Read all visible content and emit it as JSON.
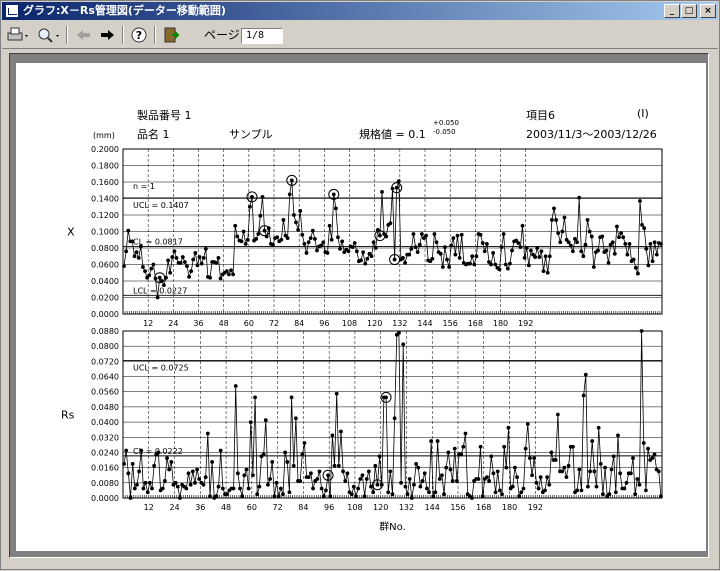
{
  "window": {
    "title": "グラフ:X－Rs管理図(データー移動範囲)",
    "minimize": "_",
    "maximize": "□",
    "close": "×"
  },
  "toolbar": {
    "icons": [
      "printer-icon",
      "zoom-icon",
      "back-arrow-icon",
      "forward-arrow-icon",
      "help-icon",
      "exit-icon"
    ],
    "page_label": "ページ:",
    "page_value": "1/8"
  },
  "report": {
    "product_no": "製品番号 1",
    "product_name": "品名 1",
    "sample": "サンプル",
    "spec_label": "規格値 = 0.1",
    "spec_plus": "+0.050",
    "spec_minus": "-0.050",
    "item": "項目6",
    "item_code": "(I)",
    "date_range": "2003/11/3～2003/12/26",
    "unit": "(mm)"
  },
  "chart_data": [
    {
      "type": "line",
      "ylabel": "X",
      "xlabel": "群No.",
      "ylim": [
        0,
        0.2
      ],
      "yticks": [
        "0.2000",
        "0.1800",
        "0.1600",
        "0.1400",
        "0.1200",
        "0.1000",
        "0.0800",
        "0.0600",
        "0.0400",
        "0.0200",
        "0.0000"
      ],
      "xticks": [
        "12",
        "24",
        "36",
        "48",
        "60",
        "72",
        "84",
        "96",
        "108",
        "120",
        "132",
        "144",
        "156",
        "168",
        "180",
        "192"
      ],
      "annotations": {
        "n": "n = 1",
        "ucl": "UCL = 0.1407",
        "cl": "CL = 0.0817",
        "lcl": "LCL = 0.0227"
      },
      "ucl": 0.1407,
      "cl": 0.0817,
      "lcl": 0.0227,
      "values": [
        0.058,
        0.076,
        0.101,
        0.088,
        0.088,
        0.07,
        0.075,
        0.068,
        0.082,
        0.057,
        0.052,
        0.044,
        0.047,
        0.055,
        0.06,
        0.043,
        0.02,
        0.044,
        0.04,
        0.035,
        0.044,
        0.065,
        0.05,
        0.069,
        0.076,
        0.068,
        0.062,
        0.062,
        0.069,
        0.063,
        0.058,
        0.045,
        0.052,
        0.066,
        0.074,
        0.059,
        0.069,
        0.061,
        0.068,
        0.079,
        0.045,
        0.044,
        0.063,
        0.063,
        0.062,
        0.068,
        0.043,
        0.048,
        0.05,
        0.052,
        0.048,
        0.053,
        0.048,
        0.107,
        0.094,
        0.089,
        0.088,
        0.1,
        0.085,
        0.09,
        0.13,
        0.142,
        0.089,
        0.091,
        0.097,
        0.119,
        0.142,
        0.101,
        0.094,
        0.104,
        0.085,
        0.084,
        0.092,
        0.093,
        0.088,
        0.09,
        0.114,
        0.095,
        0.092,
        0.145,
        0.162,
        0.12,
        0.111,
        0.102,
        0.125,
        0.096,
        0.085,
        0.074,
        0.087,
        0.092,
        0.101,
        0.091,
        0.077,
        0.082,
        0.083,
        0.087,
        0.075,
        0.074,
        0.107,
        0.09,
        0.145,
        0.128,
        0.093,
        0.079,
        0.088,
        0.075,
        0.078,
        0.076,
        0.082,
        0.081,
        0.086,
        0.076,
        0.064,
        0.065,
        0.075,
        0.061,
        0.067,
        0.073,
        0.07,
        0.087,
        0.08,
        0.102,
        0.095,
        0.148,
        0.097,
        0.094,
        0.108,
        0.11,
        0.152,
        0.066,
        0.153,
        0.161,
        0.066,
        0.068,
        0.062,
        0.072,
        0.072,
        0.079,
        0.097,
        0.081,
        0.075,
        0.084,
        0.097,
        0.092,
        0.095,
        0.065,
        0.064,
        0.067,
        0.097,
        0.087,
        0.075,
        0.073,
        0.057,
        0.081,
        0.066,
        0.057,
        0.083,
        0.092,
        0.072,
        0.095,
        0.068,
        0.096,
        0.062,
        0.06,
        0.061,
        0.061,
        0.07,
        0.06,
        0.07,
        0.097,
        0.096,
        0.086,
        0.076,
        0.085,
        0.063,
        0.06,
        0.074,
        0.06,
        0.056,
        0.054,
        0.081,
        0.097,
        0.06,
        0.055,
        0.061,
        0.077,
        0.088,
        0.089,
        0.086,
        0.081,
        0.107,
        0.068,
        0.08,
        0.059,
        0.077,
        0.072,
        0.069,
        0.08,
        0.069,
        0.076,
        0.052,
        0.07,
        0.05,
        0.07,
        0.114,
        0.128,
        0.114,
        0.098,
        0.087,
        0.1,
        0.117,
        0.09,
        0.087,
        0.083,
        0.076,
        0.091,
        0.087,
        0.141,
        0.076,
        0.07,
        0.084,
        0.114,
        0.1,
        0.094,
        0.057,
        0.075,
        0.077,
        0.093,
        0.094,
        0.075,
        0.077,
        0.062,
        0.084,
        0.087,
        0.073,
        0.106,
        0.093,
        0.098,
        0.093,
        0.085,
        0.072,
        0.085,
        0.064,
        0.066,
        0.056,
        0.049,
        0.137,
        0.108,
        0.104,
        0.079,
        0.059,
        0.085,
        0.064,
        0.087,
        0.072,
        0.086,
        0.085
      ],
      "circled": [
        17,
        61,
        67,
        80,
        100,
        122,
        129,
        130
      ]
    },
    {
      "type": "line",
      "ylabel": "Rs",
      "xlabel": "群No.",
      "ylim": [
        0,
        0.088
      ],
      "yticks": [
        "0.0880",
        "0.0800",
        "0.0720",
        "0.0640",
        "0.0560",
        "0.0480",
        "0.0400",
        "0.0320",
        "0.0240",
        "0.0160",
        "0.0080",
        "0.0000"
      ],
      "xticks": [
        "12",
        "24",
        "36",
        "48",
        "60",
        "72",
        "84",
        "96",
        "108",
        "120",
        "132",
        "144",
        "156",
        "168",
        "180",
        "192"
      ],
      "annotations": {
        "ucl": "UCL = 0.0725",
        "cl": "CL = 0.0222"
      },
      "ucl": 0.0725,
      "cl": 0.0222,
      "values": [
        0.018,
        0.025,
        0.013,
        0.0,
        0.018,
        0.005,
        0.007,
        0.014,
        0.025,
        0.005,
        0.008,
        0.003,
        0.008,
        0.005,
        0.017,
        0.023,
        0.024,
        0.004,
        0.005,
        0.009,
        0.021,
        0.015,
        0.019,
        0.007,
        0.008,
        0.006,
        0.0,
        0.007,
        0.006,
        0.005,
        0.013,
        0.007,
        0.014,
        0.008,
        0.015,
        0.01,
        0.008,
        0.007,
        0.011,
        0.034,
        0.001,
        0.019,
        0.0,
        0.001,
        0.006,
        0.025,
        0.005,
        0.002,
        0.002,
        0.004,
        0.005,
        0.005,
        0.059,
        0.013,
        0.005,
        0.001,
        0.012,
        0.015,
        0.005,
        0.04,
        0.012,
        0.053,
        0.002,
        0.006,
        0.022,
        0.023,
        0.041,
        0.007,
        0.01,
        0.019,
        0.001,
        0.008,
        0.001,
        0.005,
        0.002,
        0.024,
        0.019,
        0.003,
        0.053,
        0.017,
        0.042,
        0.009,
        0.009,
        0.023,
        0.029,
        0.011,
        0.011,
        0.013,
        0.005,
        0.009,
        0.01,
        0.014,
        0.005,
        0.001,
        0.004,
        0.012,
        0.001,
        0.033,
        0.017,
        0.055,
        0.017,
        0.035,
        0.014,
        0.009,
        0.013,
        0.003,
        0.002,
        0.006,
        0.001,
        0.005,
        0.01,
        0.012,
        0.001,
        0.01,
        0.014,
        0.006,
        0.003,
        0.017,
        0.007,
        0.022,
        0.007,
        0.053,
        0.053,
        0.003,
        0.014,
        0.002,
        0.042,
        0.086,
        0.087,
        0.008,
        0.081,
        0.006,
        0.002,
        0.01,
        0.0,
        0.007,
        0.018,
        0.016,
        0.006,
        0.009,
        0.013,
        0.005,
        0.003,
        0.03,
        0.001,
        0.003,
        0.03,
        0.01,
        0.012,
        0.002,
        0.016,
        0.024,
        0.015,
        0.009,
        0.026,
        0.009,
        0.023,
        0.023,
        0.027,
        0.034,
        0.002,
        0.001,
        0.0,
        0.009,
        0.01,
        0.01,
        0.027,
        0.001,
        0.01,
        0.011,
        0.009,
        0.022,
        0.013,
        0.003,
        0.014,
        0.004,
        0.002,
        0.027,
        0.016,
        0.037,
        0.005,
        0.006,
        0.016,
        0.011,
        0.001,
        0.003,
        0.005,
        0.026,
        0.039,
        0.021,
        0.012,
        0.021,
        0.008,
        0.005,
        0.011,
        0.003,
        0.004,
        0.011,
        0.007,
        0.024,
        0.02,
        0.02,
        0.044,
        0.014,
        0.014,
        0.016,
        0.011,
        0.017,
        0.027,
        0.027,
        0.003,
        0.004,
        0.015,
        0.004,
        0.054,
        0.065,
        0.006,
        0.014,
        0.03,
        0.014,
        0.006,
        0.037,
        0.018,
        0.002,
        0.016,
        0.001,
        0.002,
        0.015,
        0.022,
        0.003,
        0.033,
        0.013,
        0.005,
        0.005,
        0.008,
        0.013,
        0.013,
        0.021,
        0.002,
        0.01,
        0.007,
        0.088,
        0.029,
        0.004,
        0.026,
        0.02,
        0.021,
        0.023,
        0.015,
        0.014,
        0.001
      ],
      "circled": [
        95,
        118,
        122
      ]
    }
  ]
}
